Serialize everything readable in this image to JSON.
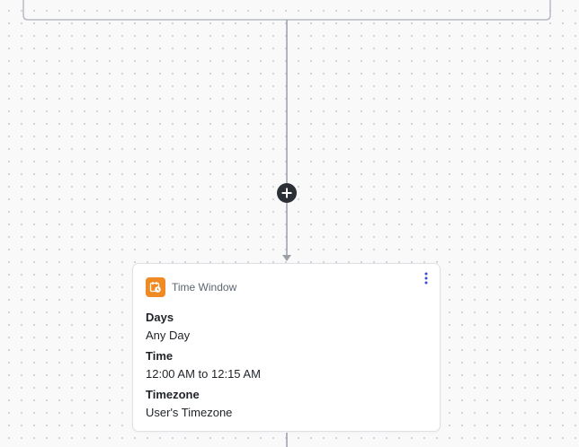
{
  "canvas": {
    "add_step_icon": "plus-icon"
  },
  "node": {
    "title": "Time Window",
    "icon": "calendar-clock-icon",
    "icon_color": "#f08a24",
    "menu_icon": "more-vertical-icon",
    "fields": [
      {
        "label": "Days",
        "value": "Any Day"
      },
      {
        "label": "Time",
        "value": "12:00 AM to 12:15 AM"
      },
      {
        "label": "Timezone",
        "value": "User's Timezone"
      }
    ]
  }
}
